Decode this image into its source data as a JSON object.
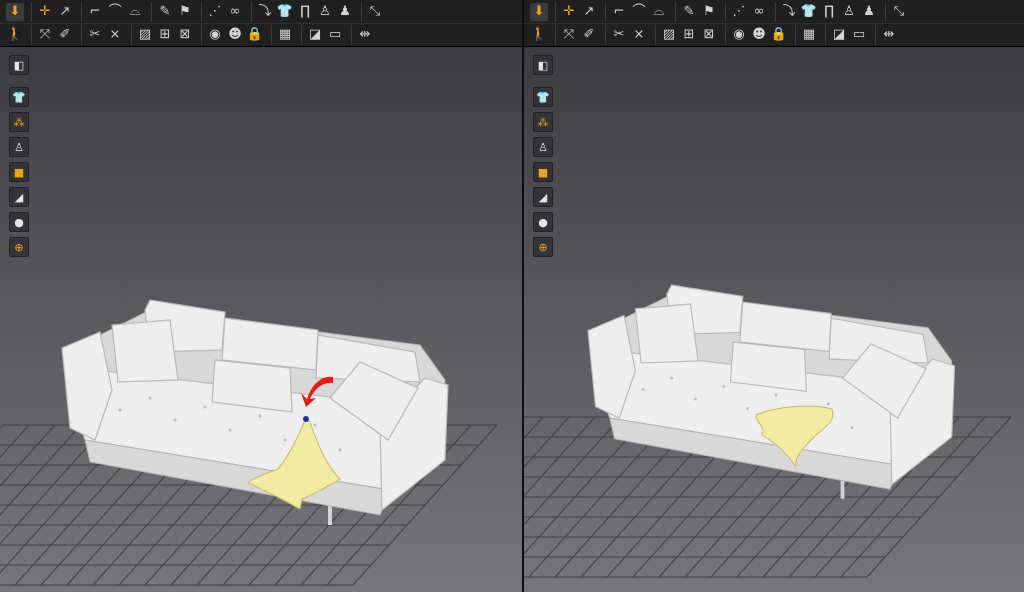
{
  "toolbar": {
    "row1_groups": [
      [
        {
          "icon": "down-arrow-icon",
          "glyph": "⬇",
          "active": true,
          "accent": true
        }
      ],
      [
        {
          "icon": "move-cross-icon",
          "glyph": "✛",
          "accent": true
        },
        {
          "icon": "select-arrow-icon",
          "glyph": "↗"
        }
      ],
      [
        {
          "icon": "edit-pattern-icon",
          "glyph": "⌐"
        },
        {
          "icon": "edit-curve-icon",
          "glyph": "⌒"
        },
        {
          "icon": "edit-segment-icon",
          "glyph": "⌓"
        }
      ],
      [
        {
          "icon": "pin-tool-icon",
          "glyph": "✎"
        },
        {
          "icon": "tack-tool-icon",
          "glyph": "⚑"
        }
      ],
      [
        {
          "icon": "add-point-icon",
          "glyph": "⋰"
        },
        {
          "icon": "sewing-icon",
          "glyph": "∞"
        }
      ],
      [
        {
          "icon": "fold-icon",
          "glyph": "⤵"
        },
        {
          "icon": "garment-icon",
          "glyph": "👕"
        },
        {
          "icon": "pants-icon",
          "glyph": "∏"
        },
        {
          "icon": "avatar-icon",
          "glyph": "♙"
        },
        {
          "icon": "avatar-pose-icon",
          "glyph": "♟"
        }
      ],
      [
        {
          "icon": "measure-icon",
          "glyph": "⤡"
        }
      ]
    ],
    "row2_groups": [
      [
        {
          "icon": "walk-icon",
          "glyph": "🚶"
        }
      ],
      [
        {
          "icon": "transform-icon",
          "glyph": "⤧"
        },
        {
          "icon": "brush-icon",
          "glyph": "✐"
        }
      ],
      [
        {
          "icon": "cut-icon",
          "glyph": "✂"
        },
        {
          "icon": "mirror-icon",
          "glyph": "⨯"
        }
      ],
      [
        {
          "icon": "texture-icon",
          "glyph": "▨"
        },
        {
          "icon": "grid-icon",
          "glyph": "⊞"
        },
        {
          "icon": "pattern-fill-icon",
          "glyph": "⊠"
        }
      ],
      [
        {
          "icon": "button-icon",
          "glyph": "◉"
        },
        {
          "icon": "zipper-icon",
          "glyph": "☻"
        },
        {
          "icon": "lock-icon",
          "glyph": "🔒"
        }
      ],
      [
        {
          "icon": "hanger-icon",
          "glyph": "▦"
        }
      ],
      [
        {
          "icon": "panel-icon",
          "glyph": "◪"
        },
        {
          "icon": "flat-panel-icon",
          "glyph": "▭"
        }
      ],
      [
        {
          "icon": "split-icon",
          "glyph": "⇹"
        }
      ]
    ]
  },
  "side_tools": [
    {
      "icon": "cube-view-icon",
      "glyph": "◧",
      "gap": true
    },
    {
      "icon": "shirt-display-icon",
      "glyph": "👕"
    },
    {
      "icon": "particle-icon",
      "glyph": "⁂",
      "orange": true
    },
    {
      "icon": "avatar-display-icon",
      "glyph": "♙"
    },
    {
      "icon": "texture-display-icon",
      "glyph": "■",
      "orange": true
    },
    {
      "icon": "mesh-display-icon",
      "glyph": "◢"
    },
    {
      "icon": "avatar-silhouette-icon",
      "glyph": "●"
    },
    {
      "icon": "world-grid-icon",
      "glyph": "⊕",
      "orange": true
    }
  ]
}
